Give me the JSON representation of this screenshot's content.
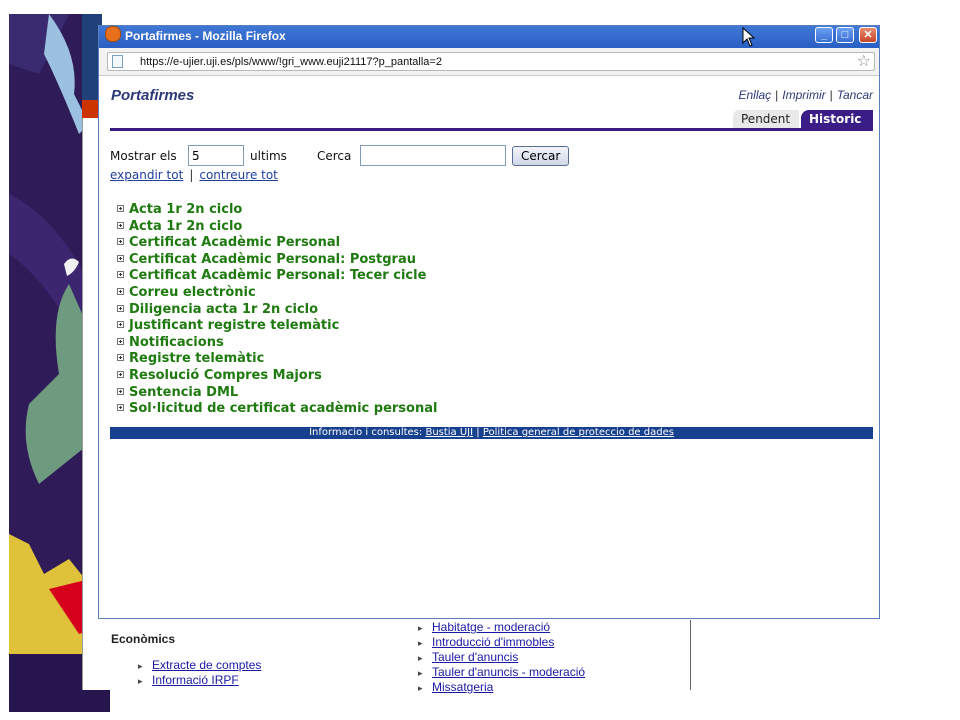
{
  "window": {
    "title": "Portafirmes - Mozilla Firefox",
    "url": "https://e-ujier.uji.es/pls/www/!gri_www.euji21117?p_pantalla=2",
    "controls": {
      "minimize": "_",
      "maximize": "□",
      "close": "✕"
    }
  },
  "app": {
    "title": "Portafirmes",
    "top_links": [
      "Enllaç",
      "Imprimir",
      "Tancar"
    ],
    "tabs": {
      "pendent": "Pendent",
      "historic": "Historic"
    }
  },
  "filter": {
    "show_label": "Mostrar els",
    "count_value": "5",
    "last_label": "ultims",
    "search_label": "Cerca",
    "search_value": "",
    "search_button": "Cercar"
  },
  "expand": {
    "expand_all": "expandir tot",
    "separator": "|",
    "collapse_all": "contreure tot"
  },
  "documents": [
    "Acta 1r 2n ciclo",
    "Acta 1r 2n ciclo",
    "Certificat Acadèmic Personal",
    "Certificat Acadèmic Personal: Postgrau",
    "Certificat Acadèmic Personal: Tecer cicle",
    "Correu electrònic",
    "Diligencia acta 1r 2n ciclo",
    "Justificant registre telemàtic",
    "Notificacions",
    "Registre telemàtic",
    "Resolució Compres Majors",
    "Sentencia DML",
    "Sol·licitud de certificat acadèmic personal"
  ],
  "footer": {
    "prefix": "Informacio i consultes:",
    "link1": "Bustia UJI",
    "separator": "|",
    "link2": "Politica general de proteccio de dades"
  },
  "background_page": {
    "heading": "Econòmics",
    "left_links": [
      "Extracte de comptes",
      "Informació IRPF"
    ],
    "right_links": [
      "Habitatge - moderació",
      "Introducció d'immobles",
      "Tauler d'anuncis",
      "Tauler d'anuncis - moderació",
      "Missatgeria"
    ]
  },
  "colors": {
    "accent": "#3a1d86",
    "doc_text": "#1f7a10",
    "footer_bg": "#17408f",
    "title_text": "#2c3a78"
  }
}
